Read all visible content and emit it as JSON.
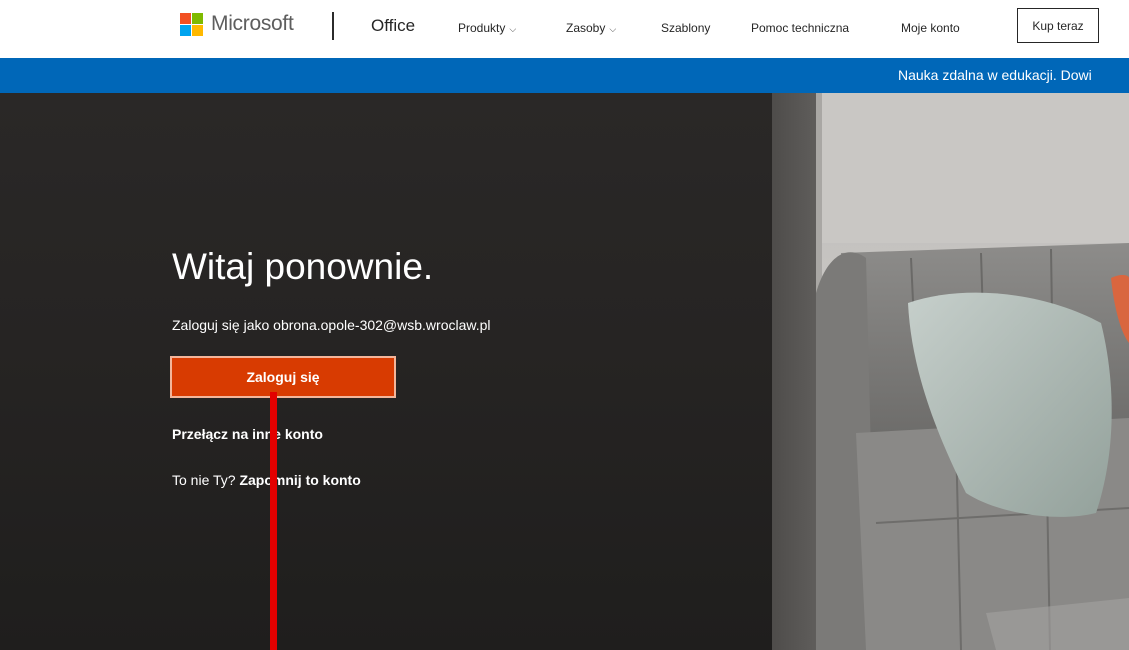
{
  "header": {
    "brand": "Microsoft",
    "product": "Office",
    "nav": [
      {
        "label": "Produkty",
        "has_dropdown": true
      },
      {
        "label": "Zasoby",
        "has_dropdown": true
      },
      {
        "label": "Szablony",
        "has_dropdown": false
      },
      {
        "label": "Pomoc techniczna",
        "has_dropdown": false
      },
      {
        "label": "Moje konto",
        "has_dropdown": false
      }
    ],
    "buy_label": "Kup teraz",
    "logo_colors": [
      "#f25022",
      "#7fba00",
      "#00a4ef",
      "#ffb900"
    ]
  },
  "banner": {
    "text": "Nauka zdalna w edukacji. Dowi",
    "color": "#0067b8"
  },
  "hero": {
    "title": "Witaj ponownie.",
    "subtitle": "Zaloguj się jako obrona.opole-302@wsb.wroclaw.pl",
    "signin_label": "Zaloguj się",
    "switch_account": "Przełącz na inne konto",
    "not_you_prefix": "To nie Ty?",
    "forget_account": "Zapomnij to konto",
    "accent_color": "#d83b01"
  },
  "annotation": {
    "marker_color": "#e30000"
  }
}
